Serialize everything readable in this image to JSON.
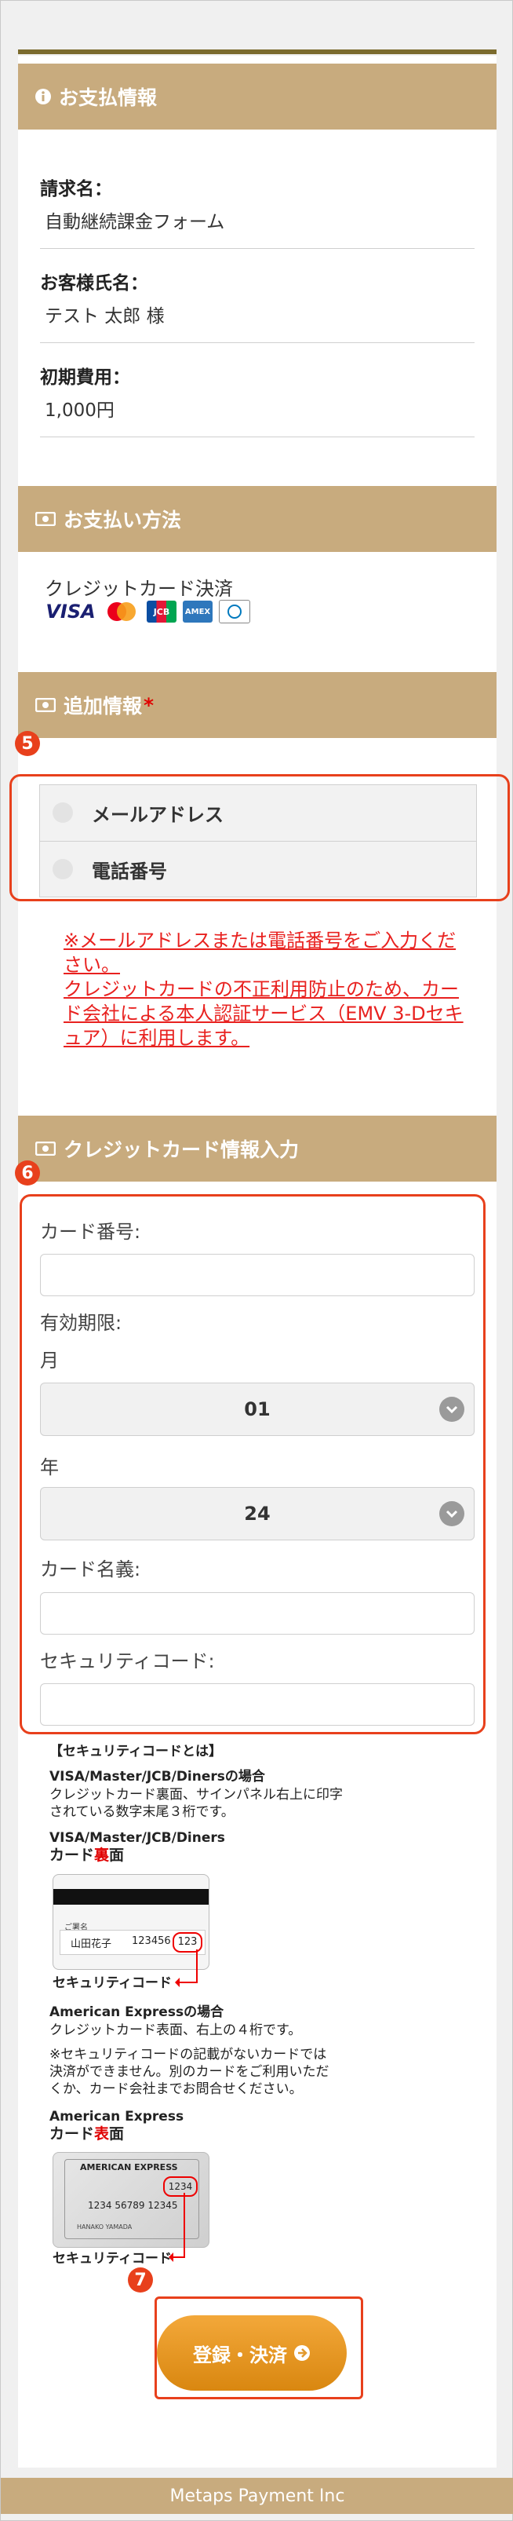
{
  "payment_info": {
    "header": "お支払情報",
    "billing_label": "請求名：",
    "billing_value": "自動継続課金フォーム",
    "customer_label": "お客様氏名：",
    "customer_value": "テスト 太郎 様",
    "fee_label": "初期費用：",
    "fee_value": "1,000円"
  },
  "payment_method": {
    "header": "お支払い方法",
    "method": "クレジットカード決済",
    "brands": [
      "VISA",
      "Mastercard",
      "JCB",
      "American Express",
      "Diners Club"
    ]
  },
  "additional_info": {
    "header": "追加情報",
    "required_mark": "*",
    "step_number": "5",
    "options": [
      "メールアドレス",
      "電話番号"
    ],
    "notice_line1": "※メールアドレスまたは電話番号をご入力ください。",
    "notice_line2": "クレジットカードの不正利用防止のため、カード会社による本人認証サービス（EMV 3-Dセキュア）に利用します。"
  },
  "card_input": {
    "header": "クレジットカード情報入力",
    "step_number": "6",
    "card_number_label": "カード番号:",
    "expiry_label": "有効期限:",
    "month_label": "月",
    "month_value": "01",
    "year_label": "年",
    "year_value": "24",
    "holder_label": "カード名義:",
    "security_label": "セキュリティコード:"
  },
  "security_help": {
    "title": "【セキュリティコードとは】",
    "visa_heading": "VISA/Master/JCB/Dinersの場合",
    "visa_text_1": "クレジットカード裏面、サインパネル右上に印字",
    "visa_text_2": "されている数字末尾３桁です。",
    "visa_caption": "VISA/Master/JCB/Diners",
    "visa_side_a": "カード",
    "visa_side_b": "裏",
    "visa_side_c": "面",
    "visa_card_name_small": "ご署名",
    "visa_card_name": "山田花子",
    "visa_card_digits": "123456",
    "visa_card_code": "123",
    "code_label": "セキュリティコード",
    "amex_heading": "American Expressの場合",
    "amex_text_1": "クレジットカード表面、右上の４桁です。",
    "amex_note_1": "※セキュリティコードの記載がないカードでは",
    "amex_note_2": "決済ができません。別のカードをご利用いただ",
    "amex_note_3": "くか、カード会社までお問合せください。",
    "amex_caption": "American Express",
    "amex_side_a": "カード",
    "amex_side_b": "表",
    "amex_side_c": "面",
    "amex_card_brand": "AMERICAN EXPRESS",
    "amex_card_code": "1234",
    "amex_card_number": "1234 56789 12345",
    "amex_card_holder": "HANAKO YAMADA"
  },
  "submit": {
    "label": "登録・決済",
    "step_number": "7"
  },
  "footer": {
    "text": "Metaps Payment Inc"
  },
  "colors": {
    "section_header": "#c8ab7e",
    "highlight": "#e8401c",
    "notice": "#e8211f",
    "button": "#e8961f"
  }
}
